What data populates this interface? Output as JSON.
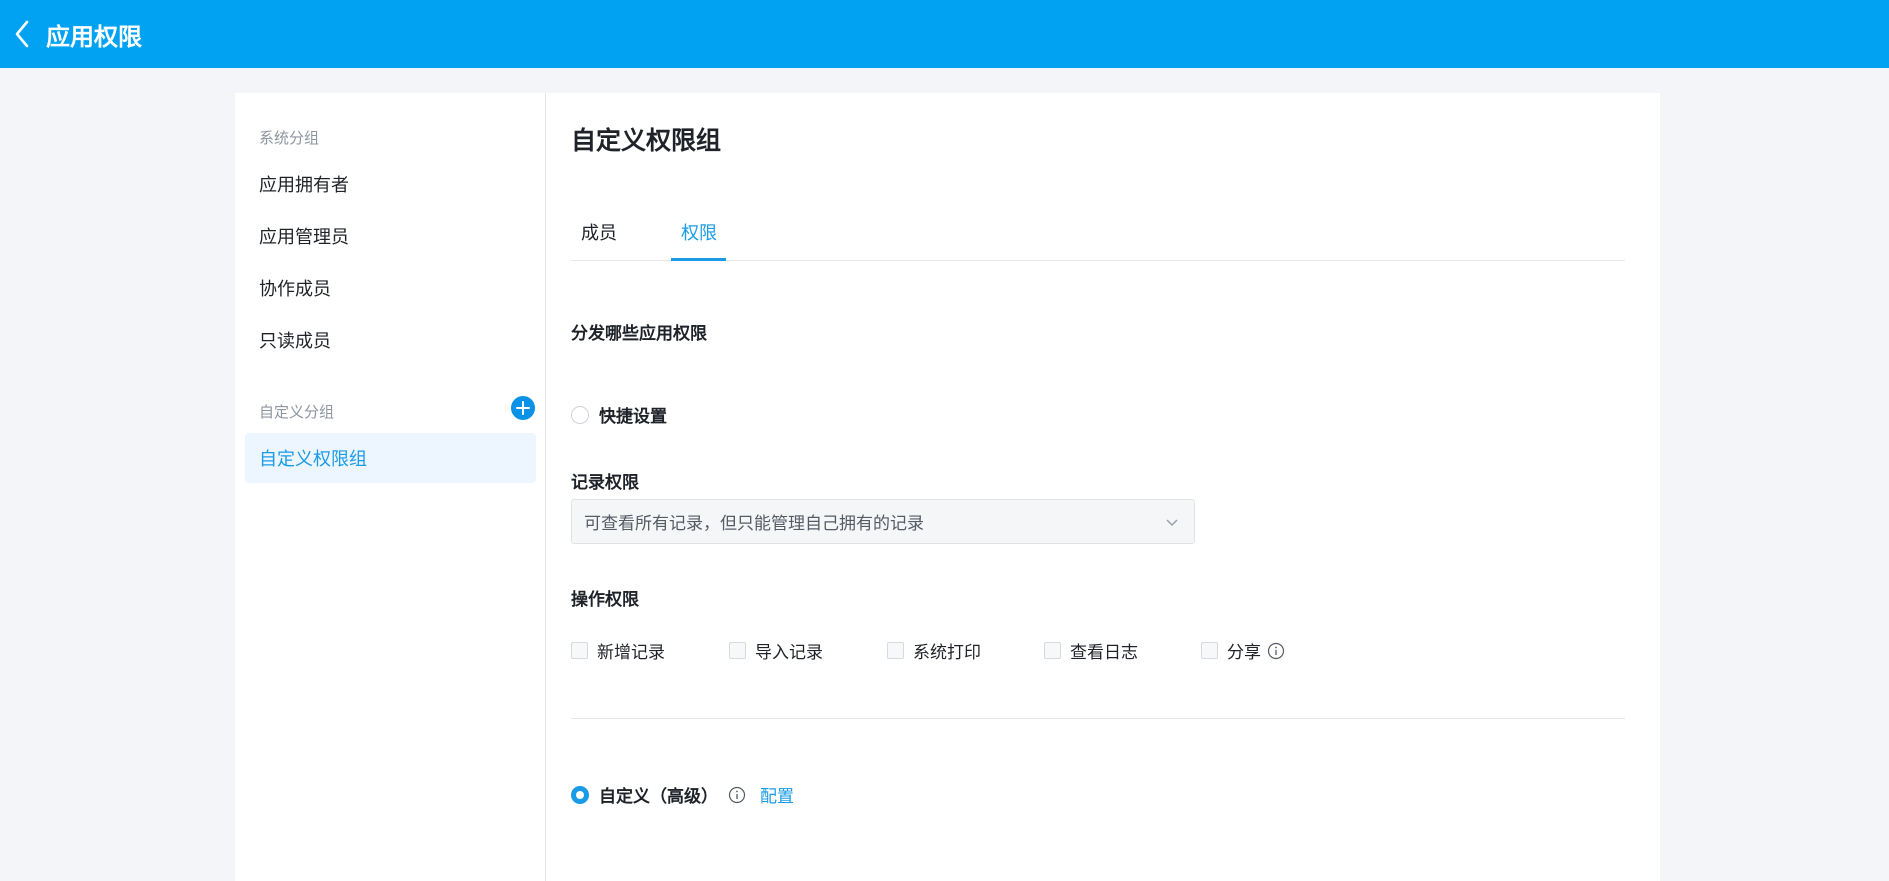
{
  "header": {
    "title": "应用权限"
  },
  "sidebar": {
    "system_group_title": "系统分组",
    "system_items": [
      {
        "label": "应用拥有者"
      },
      {
        "label": "应用管理员"
      },
      {
        "label": "协作成员"
      },
      {
        "label": "只读成员"
      }
    ],
    "custom_group_title": "自定义分组",
    "custom_items": [
      {
        "label": "自定义权限组",
        "active": true
      }
    ]
  },
  "main": {
    "title": "自定义权限组",
    "tabs": [
      {
        "label": "成员"
      },
      {
        "label": "权限",
        "active": true
      }
    ],
    "distribute_title": "分发哪些应用权限",
    "quick_setting_label": "快捷设置",
    "record_permission": {
      "label": "记录权限",
      "selected": "可查看所有记录，但只能管理自己拥有的记录"
    },
    "operation_permission": {
      "label": "操作权限",
      "options": [
        {
          "label": "新增记录",
          "checked": false
        },
        {
          "label": "导入记录",
          "checked": false
        },
        {
          "label": "系统打印",
          "checked": false
        },
        {
          "label": "查看日志",
          "checked": false
        },
        {
          "label": "分享",
          "checked": false
        }
      ]
    },
    "custom_advanced_label": "自定义（高级）",
    "config_link": "配置"
  },
  "colors": {
    "header_bg": "#01a2f2",
    "accent": "#1a9be8",
    "active_item_bg": "#edf5ff"
  }
}
